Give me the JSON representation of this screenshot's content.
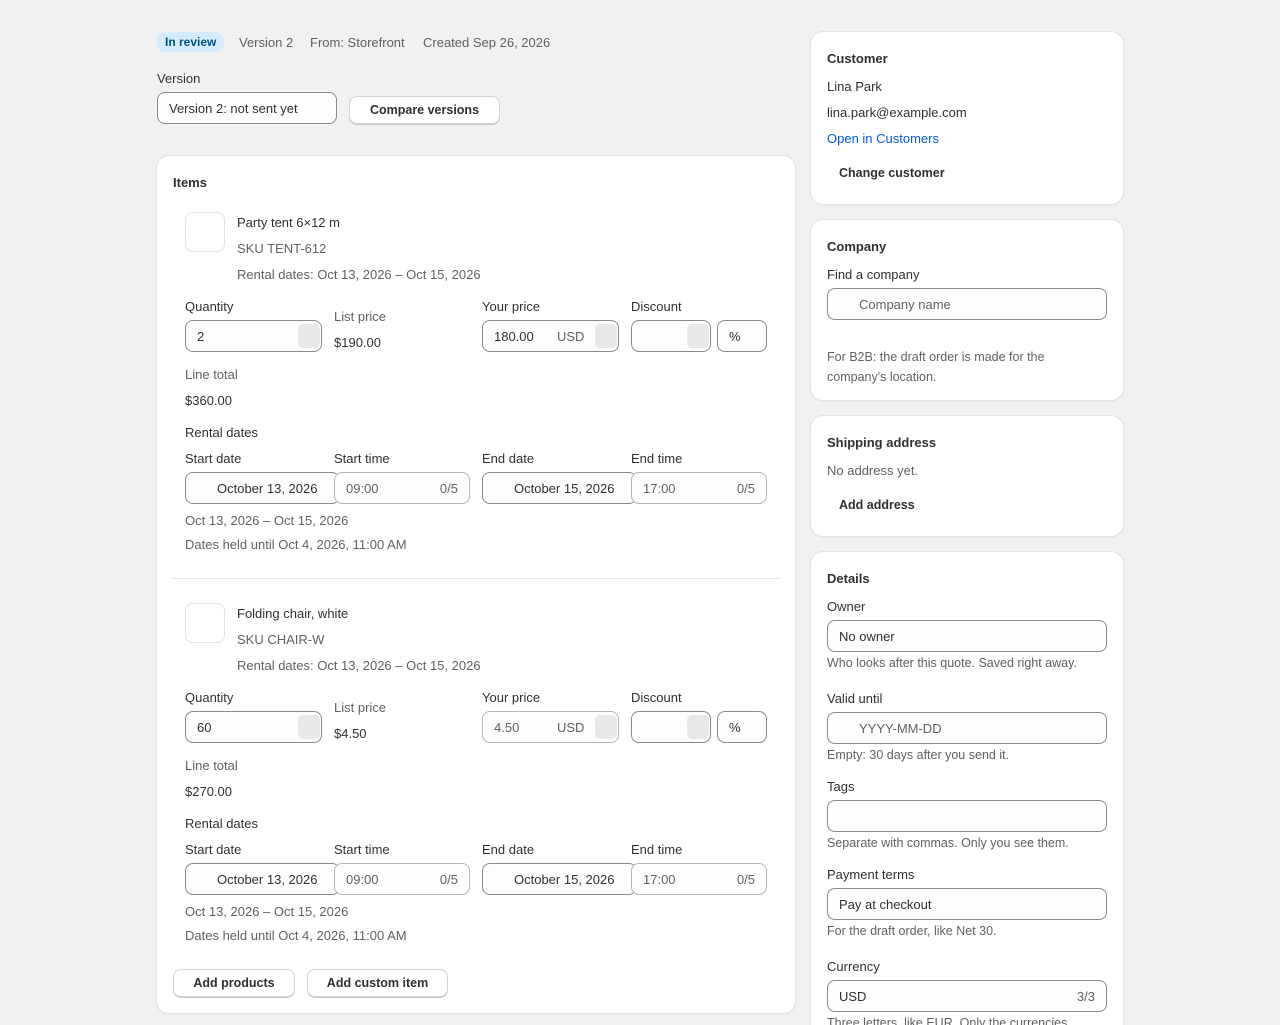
{
  "header": {
    "status_badge": "In review",
    "version": "Version 2",
    "source": "From: Storefront",
    "created": "Created Sep 26, 2026"
  },
  "version_select": {
    "label": "Version",
    "value": "Version 2: not sent yet",
    "compare_label": "Compare versions"
  },
  "items_card": {
    "title": "Items",
    "common": {
      "quantity_label": "Quantity",
      "list_price_label": "List price",
      "your_price_label": "Your price",
      "discount_label": "Discount",
      "currency": "USD",
      "percent": "%",
      "line_total_label": "Line total",
      "rental_dates_label": "Rental dates",
      "start_date_label": "Start date",
      "start_time_label": "Start time",
      "end_date_label": "End date",
      "end_time_label": "End time",
      "time_counter": "0/5"
    },
    "items": [
      {
        "name": "Party tent 6×12 m",
        "sku": "SKU TENT-612",
        "rental_dates": "Rental dates: Oct 13, 2026 – Oct 15, 2026",
        "quantity": "2",
        "list_price": "$190.00",
        "your_price": "180.00",
        "discount": "",
        "line_total": "$360.00",
        "start_date": "October 13, 2026",
        "start_time": "09:00",
        "end_date": "October 15, 2026",
        "end_time": "17:00",
        "range_summary": "Oct 13, 2026 – Oct 15, 2026",
        "hold_note": "Dates held until Oct 4, 2026, 11:00 AM"
      },
      {
        "name": "Folding chair, white",
        "sku": "SKU CHAIR-W",
        "rental_dates": "Rental dates: Oct 13, 2026 – Oct 15, 2026",
        "quantity": "60",
        "list_price": "$4.50",
        "your_price": "4.50",
        "discount": "",
        "line_total": "$270.00",
        "start_date": "October 13, 2026",
        "start_time": "09:00",
        "end_date": "October 15, 2026",
        "end_time": "17:00",
        "range_summary": "Oct 13, 2026 – Oct 15, 2026",
        "hold_note": "Dates held until Oct 4, 2026, 11:00 AM"
      }
    ],
    "add_products_label": "Add products",
    "add_custom_label": "Add custom item"
  },
  "customer_card": {
    "title": "Customer",
    "name": "Lina Park",
    "email": "lina.park@example.com",
    "open_link": "Open in Customers",
    "change_label": "Change customer"
  },
  "company_card": {
    "title": "Company",
    "find_label": "Find a company",
    "placeholder": "Company name",
    "help": "For B2B: the draft order is made for the company's location."
  },
  "shipping_card": {
    "title": "Shipping address",
    "empty": "No address yet.",
    "add_label": "Add address"
  },
  "details_card": {
    "title": "Details",
    "owner_label": "Owner",
    "owner_value": "No owner",
    "owner_help": "Who looks after this quote. Saved right away.",
    "valid_label": "Valid until",
    "valid_placeholder": "YYYY-MM-DD",
    "valid_help": "Empty: 30 days after you send it.",
    "tags_label": "Tags",
    "tags_value": "",
    "tags_help": "Separate with commas. Only you see them.",
    "terms_label": "Payment terms",
    "terms_value": "Pay at checkout",
    "terms_help": "For the draft order, like Net 30.",
    "currency_label": "Currency",
    "currency_value": "USD",
    "currency_counter": "3/3",
    "currency_help": "Three letters, like EUR. Only the currencies"
  }
}
